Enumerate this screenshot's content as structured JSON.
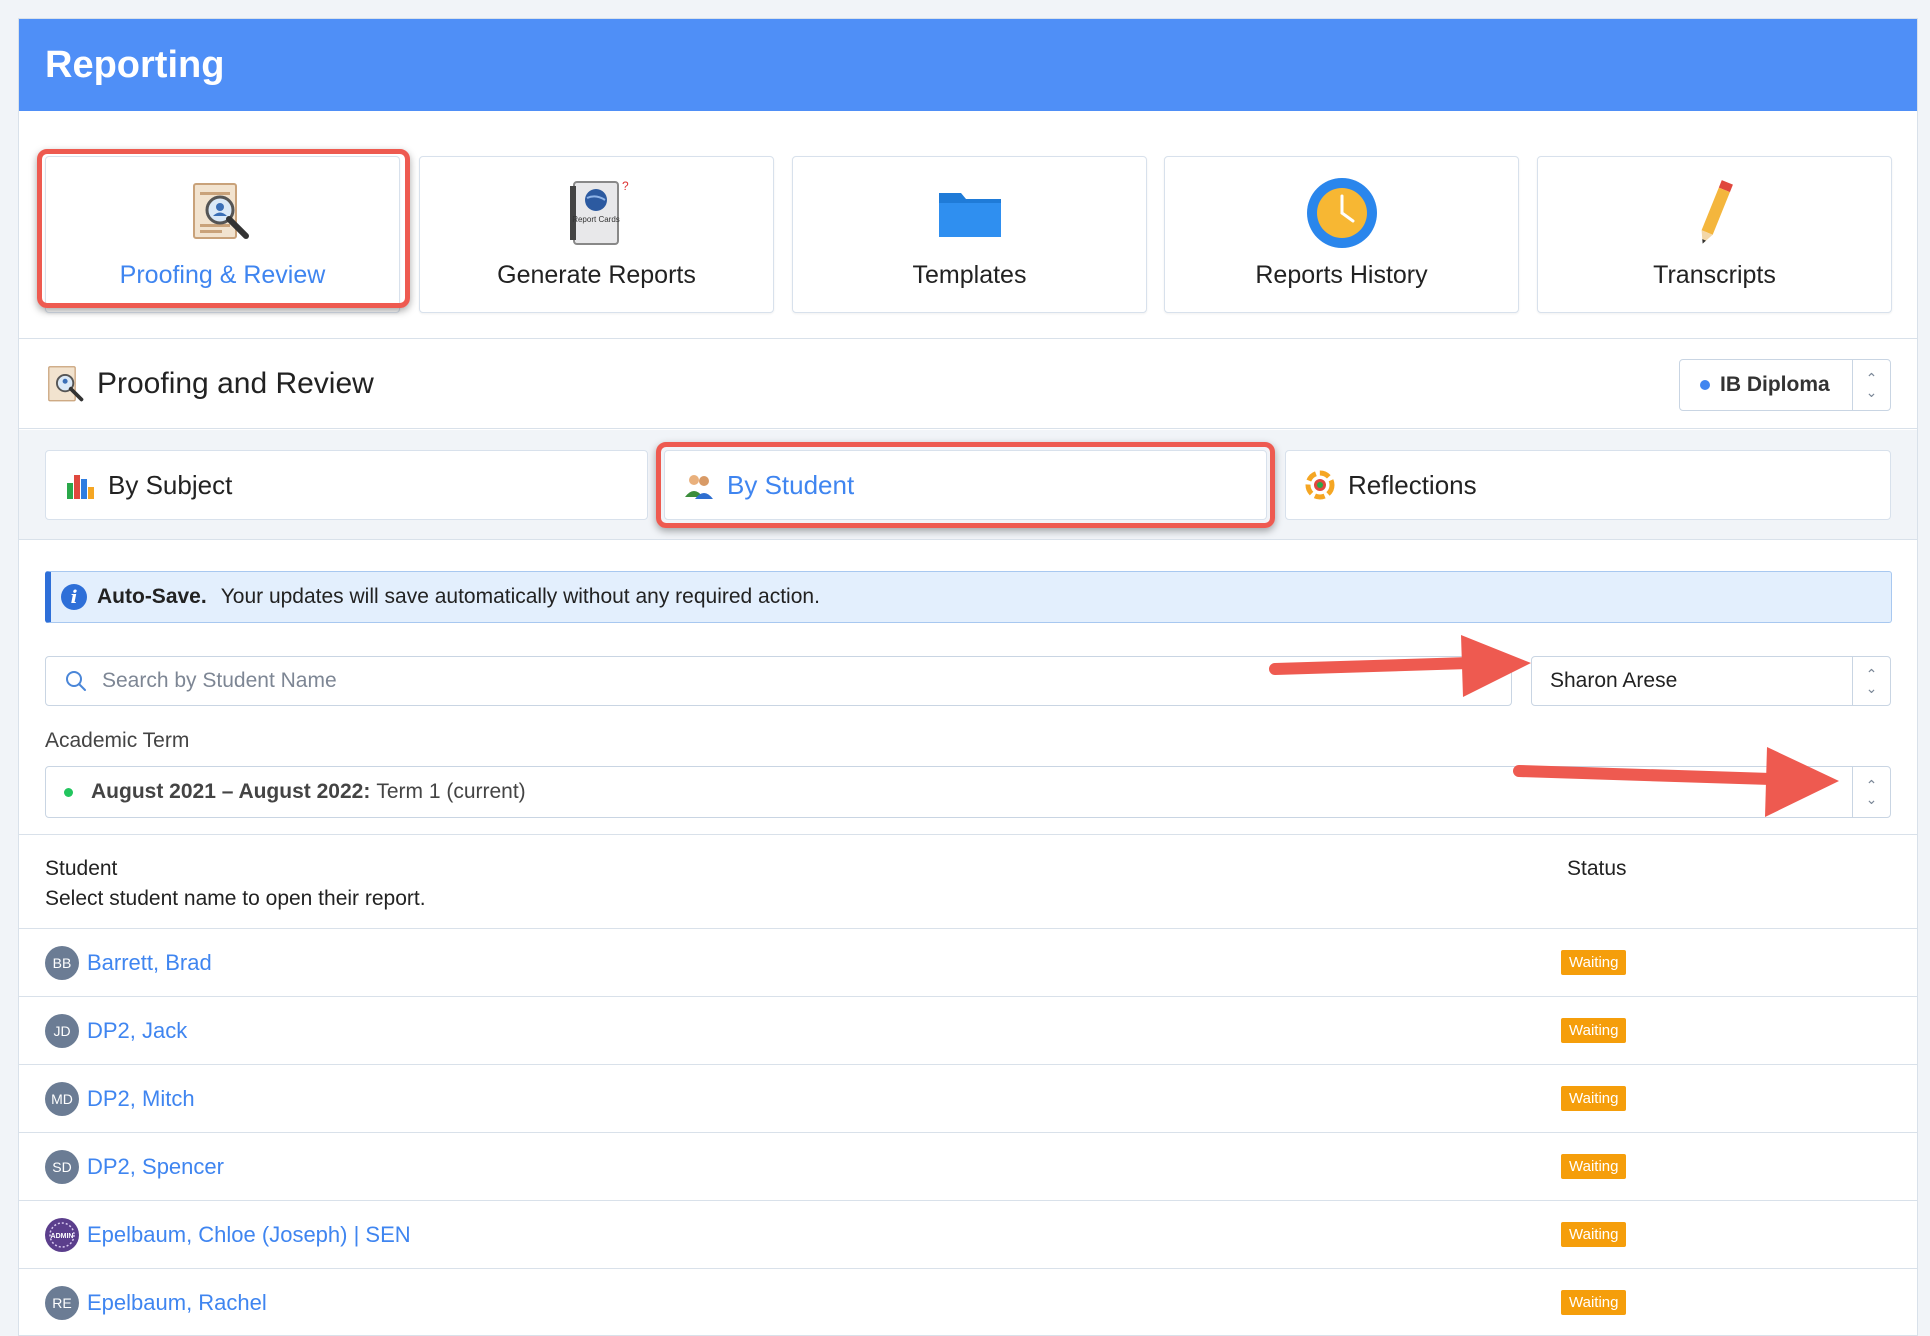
{
  "header": {
    "title": "Reporting"
  },
  "nav_tiles": [
    {
      "label": "Proofing & Review",
      "icon": "proofing-magnifier-icon",
      "active": true
    },
    {
      "label": "Generate Reports",
      "icon": "report-cards-book-icon",
      "icon_text": "Report Cards"
    },
    {
      "label": "Templates",
      "icon": "folder-icon"
    },
    {
      "label": "Reports History",
      "icon": "clock-icon"
    },
    {
      "label": "Transcripts",
      "icon": "pencil-icon"
    }
  ],
  "section": {
    "title": "Proofing and Review",
    "program_select": {
      "value": "IB Diploma",
      "dot_color": "#3f85f0"
    }
  },
  "subtabs": [
    {
      "label": "By Subject",
      "icon": "bar-chart-icon"
    },
    {
      "label": "By Student",
      "icon": "students-icon",
      "active": true
    },
    {
      "label": "Reflections",
      "icon": "reflections-gear-icon"
    }
  ],
  "alert": {
    "title": "Auto-Save.",
    "message": "Your updates will save automatically without any required action."
  },
  "search": {
    "placeholder": "Search by Student Name"
  },
  "teacher_select": {
    "value": "Sharon Arese"
  },
  "academic_term": {
    "label": "Academic Term",
    "year": "August 2021 – August 2022:",
    "term": "Term 1 (current)",
    "dot_color": "#22c55e"
  },
  "table": {
    "student_header": "Student",
    "student_subheader": "Select student name to open their report.",
    "status_header": "Status",
    "rows": [
      {
        "initials": "BB",
        "name": "Barrett, Brad",
        "status": "Waiting"
      },
      {
        "initials": "JD",
        "name": "DP2, Jack",
        "status": "Waiting"
      },
      {
        "initials": "MD",
        "name": "DP2, Mitch",
        "status": "Waiting"
      },
      {
        "initials": "SD",
        "name": "DP2, Spencer",
        "status": "Waiting"
      },
      {
        "initials": "ADMIN",
        "name": "Epelbaum, Chloe (Joseph) | SEN",
        "status": "Waiting"
      },
      {
        "initials": "RE",
        "name": "Epelbaum, Rachel",
        "status": "Waiting"
      }
    ]
  },
  "colors": {
    "header_bg": "#4f8ff7",
    "link": "#3f85f0",
    "highlight": "#ee5a50",
    "status_waiting": "#f59e0b"
  }
}
